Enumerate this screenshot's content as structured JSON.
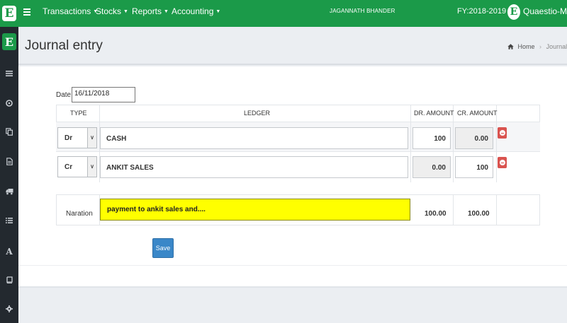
{
  "app": {
    "logo_letter": "E",
    "user_name": "JAGANNATH BHANDER",
    "fiscal_year": "FY:2018-2019",
    "company_letter": "E",
    "company_name": "Quaestio-MediSe"
  },
  "nav": {
    "items": [
      {
        "label": "Transactions"
      },
      {
        "label": "Stocks"
      },
      {
        "label": "Reports"
      },
      {
        "label": "Accounting"
      }
    ]
  },
  "sidebar": {
    "icons": [
      "list-icon",
      "dashboard-icon",
      "copy-icon",
      "file-icon",
      "truck-icon",
      "list-alt-icon",
      "font-icon",
      "book-icon",
      "gear-icon"
    ]
  },
  "page": {
    "title": "Journal entry",
    "breadcrumb_home": "Home",
    "breadcrumb_current": "Journal Ent"
  },
  "form": {
    "date_label": "Date",
    "date_value": "16/11/2018",
    "headers": {
      "type": "TYPE",
      "ledger": "LEDGER",
      "dr_amount": "DR. AMOUNT",
      "cr_amount": "CR. AMOUNT"
    },
    "rows": [
      {
        "type": "Dr",
        "ledger": "CASH",
        "dr": "100",
        "cr": "0.00"
      },
      {
        "type": "Cr",
        "ledger": "ANKIT SALES",
        "dr": "0.00",
        "cr": "100"
      }
    ],
    "narration_label": "Naration",
    "narration_value": "payment to ankit sales and....",
    "total_dr": "100.00",
    "total_cr": "100.00",
    "save_label": "Save"
  },
  "colors": {
    "brand_green": "#1b9a49",
    "sidebar_dark": "#23292f",
    "narration_highlight": "#ffff00",
    "save_blue": "#3a87c8",
    "delete_red": "#d9534f"
  }
}
